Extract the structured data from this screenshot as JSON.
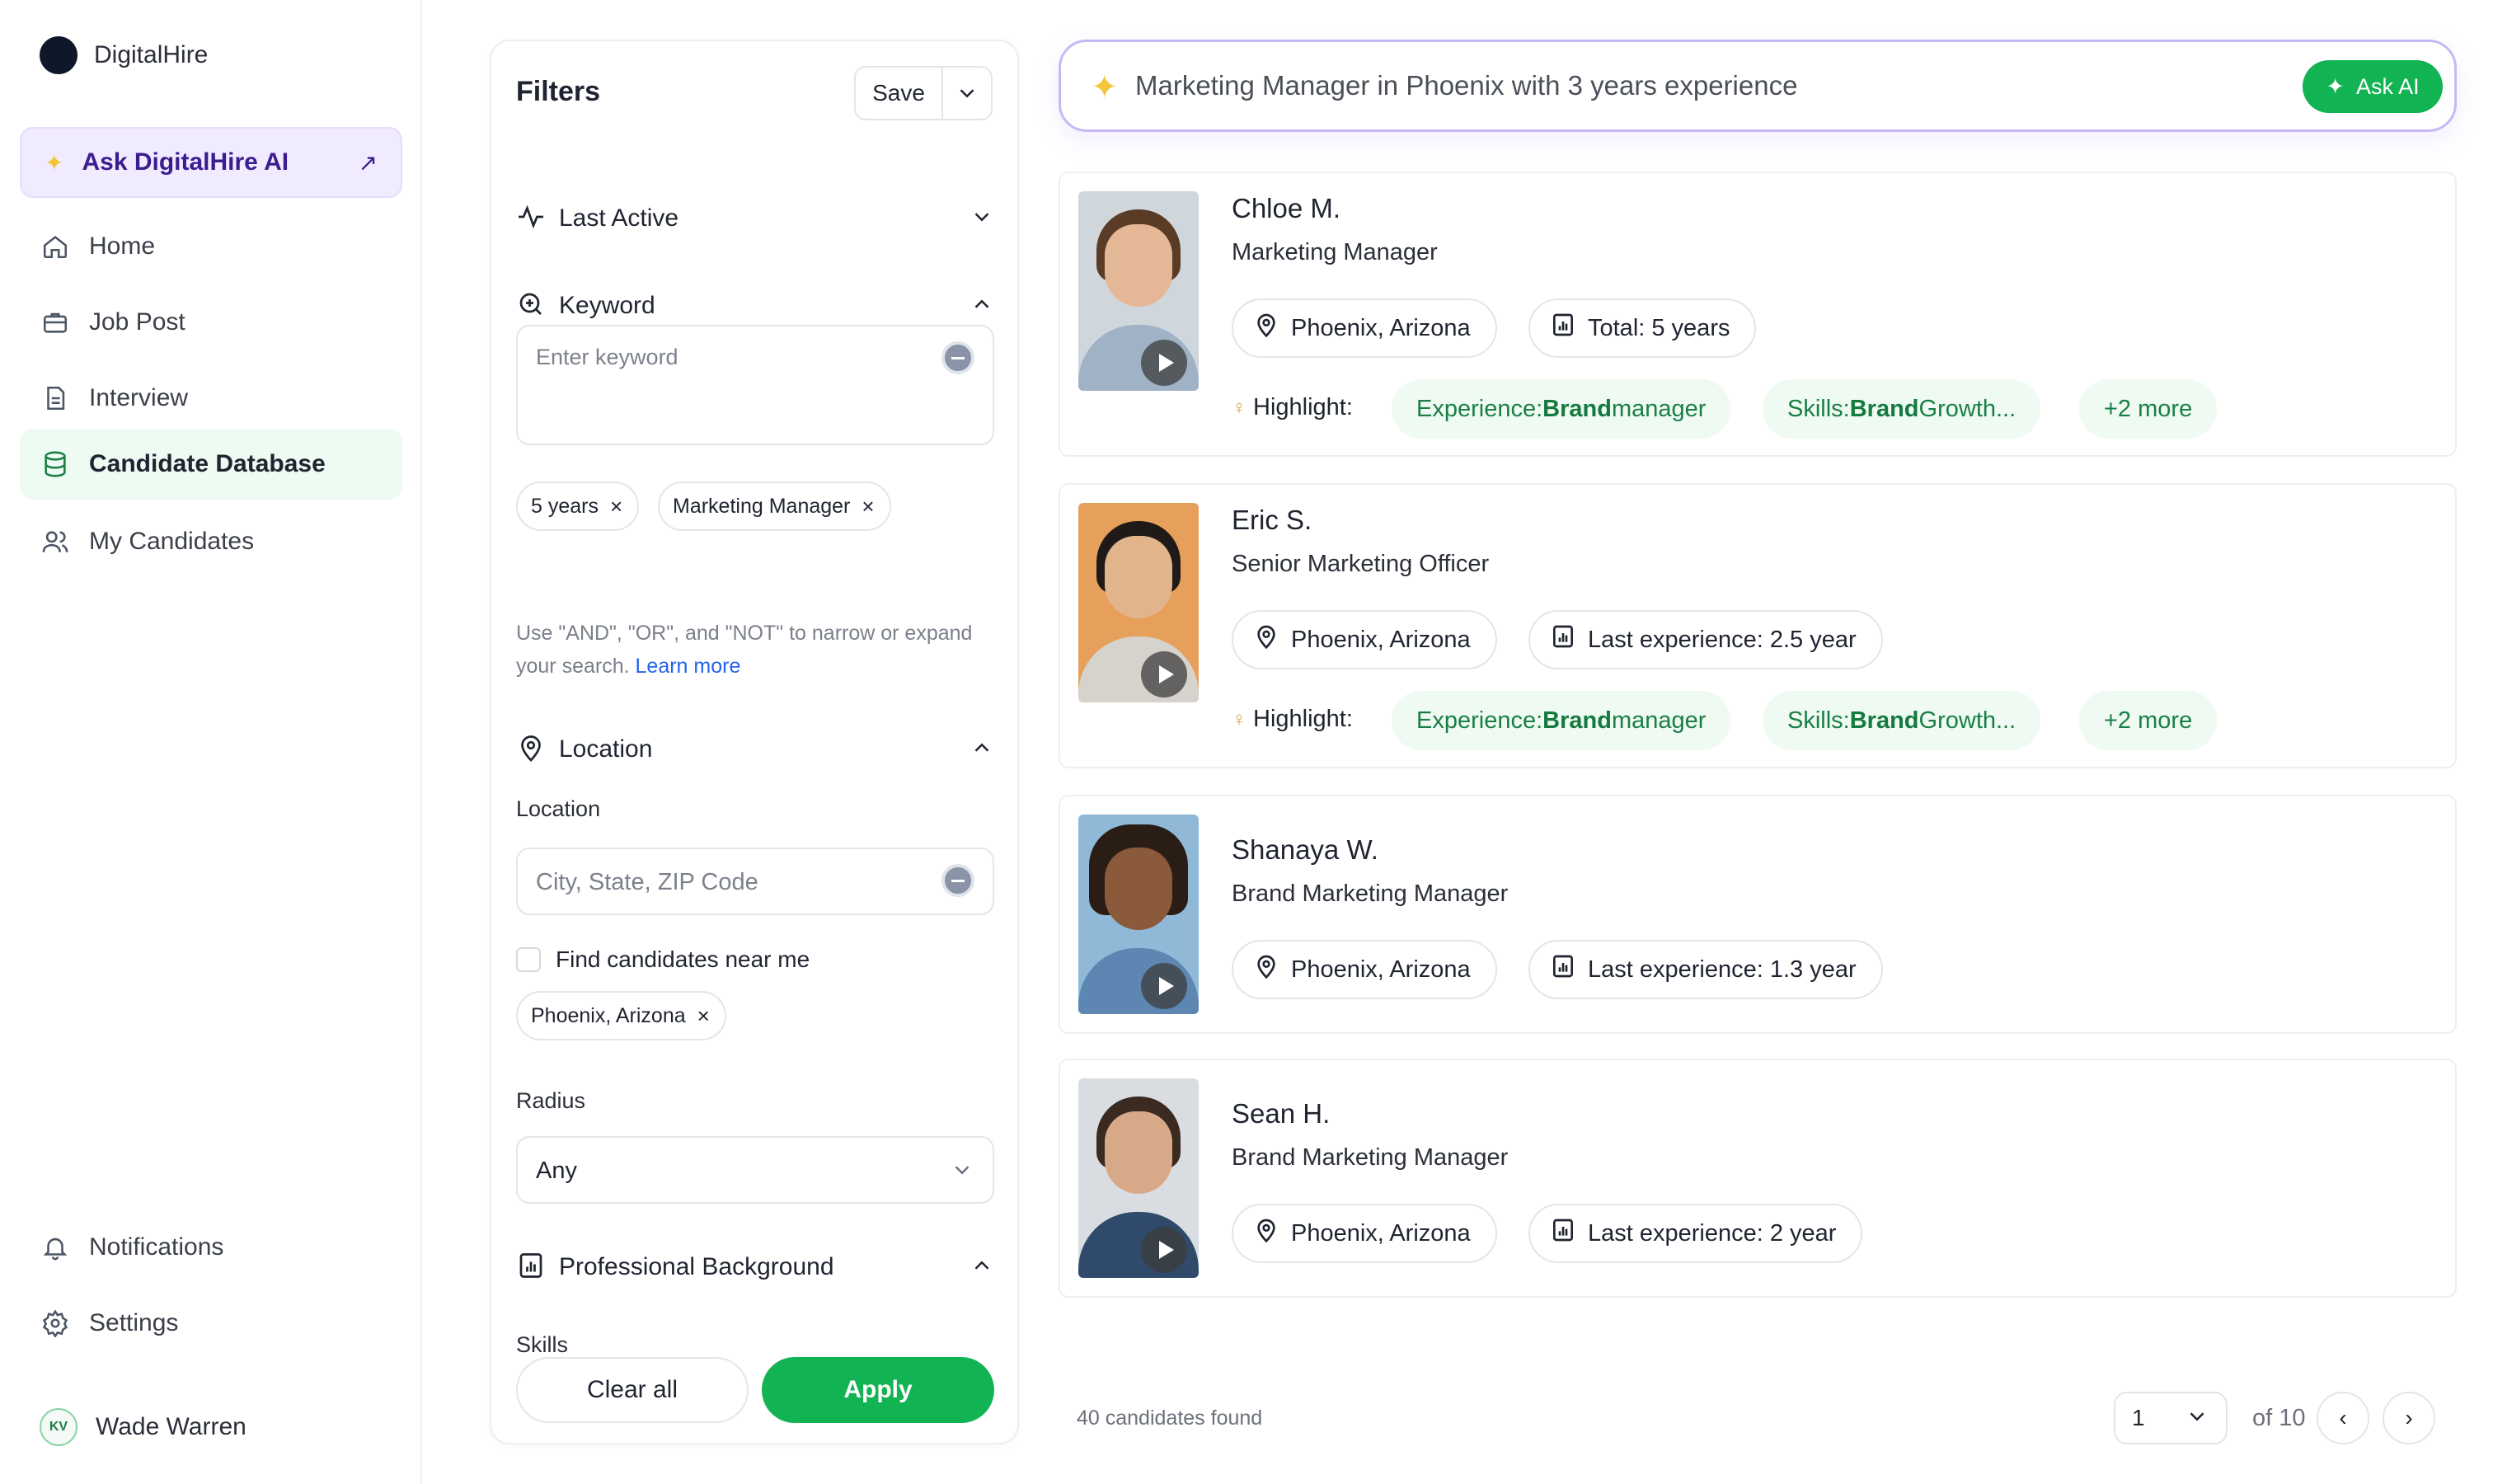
{
  "brand": {
    "name": "DigitalHire",
    "logo_text": "DigitalHire"
  },
  "sidebar": {
    "ask_ai": {
      "label": "Ask DigitalHire AI",
      "icon": "sparkle-icon",
      "arrow": "↗"
    },
    "items": [
      {
        "label": "Home",
        "icon": "home-icon"
      },
      {
        "label": "Job Post",
        "icon": "briefcase-icon"
      },
      {
        "label": "Interview",
        "icon": "document-icon"
      },
      {
        "label": "Candidate Database",
        "icon": "database-icon",
        "active": true
      },
      {
        "label": "My Candidates",
        "icon": "users-icon"
      }
    ],
    "bottom_items": [
      {
        "label": "Notifications",
        "icon": "bell-icon"
      },
      {
        "label": "Settings",
        "icon": "gear-icon"
      }
    ],
    "user": {
      "initials": "KV",
      "name": "Wade Warren"
    }
  },
  "filters": {
    "title": "Filters",
    "save_label": "Save",
    "last_active": {
      "label": "Last Active"
    },
    "keyword": {
      "label": "Keyword",
      "placeholder": "Enter keyword",
      "chips": [
        "5 years",
        "Marketing Manager"
      ],
      "hint": "Use \"AND\", \"OR\", and \"NOT\" to narrow or expand your search.",
      "hint_link": "Learn more"
    },
    "location": {
      "label": "Location",
      "field_label": "Location",
      "placeholder": "City, State, ZIP Code",
      "near_me": "Find candidates near me",
      "chips": [
        "Phoenix, Arizona"
      ],
      "radius_label": "Radius",
      "radius_value": "Any"
    },
    "professional": {
      "label": "Professional Background",
      "skills_label": "Skills"
    },
    "clear_label": "Clear all",
    "apply_label": "Apply"
  },
  "search": {
    "query": "Marketing Manager in Phoenix with 3 years experience",
    "ask_label": "Ask AI"
  },
  "candidates": [
    {
      "name": "Chloe M.",
      "title": "Marketing Manager",
      "location": "Phoenix, Arizona",
      "experience": "Total: 5 years",
      "highlight_label": "Highlight:",
      "highlights": [
        {
          "prefix": "Experience: ",
          "value": "Brand",
          "suffix": " manager"
        },
        {
          "prefix": "Skills: ",
          "value": "Brand",
          "suffix": " Growth..."
        }
      ],
      "more": "+2 more"
    },
    {
      "name": "Eric S.",
      "title": "Senior Marketing Officer",
      "location": "Phoenix, Arizona",
      "experience": "Last experience: 2.5 year",
      "highlight_label": "Highlight:",
      "highlights": [
        {
          "prefix": "Experience: ",
          "value": "Brand",
          "suffix": " manager"
        },
        {
          "prefix": "Skills: ",
          "value": "Brand",
          "suffix": " Growth..."
        }
      ],
      "more": "+2 more"
    },
    {
      "name": "Shanaya W.",
      "title": "Brand Marketing Manager",
      "location": "Phoenix, Arizona",
      "experience": "Last experience: 1.3 year"
    },
    {
      "name": "Sean H.",
      "title": "Brand Marketing Manager",
      "location": "Phoenix, Arizona",
      "experience": "Last experience: 2 year"
    }
  ],
  "results": {
    "count_text": "40 candidates found",
    "page_value": "1",
    "of_text": "of 10"
  },
  "colors": {
    "accent_green": "#12b353",
    "ai_purple": "#3b1d8f"
  }
}
